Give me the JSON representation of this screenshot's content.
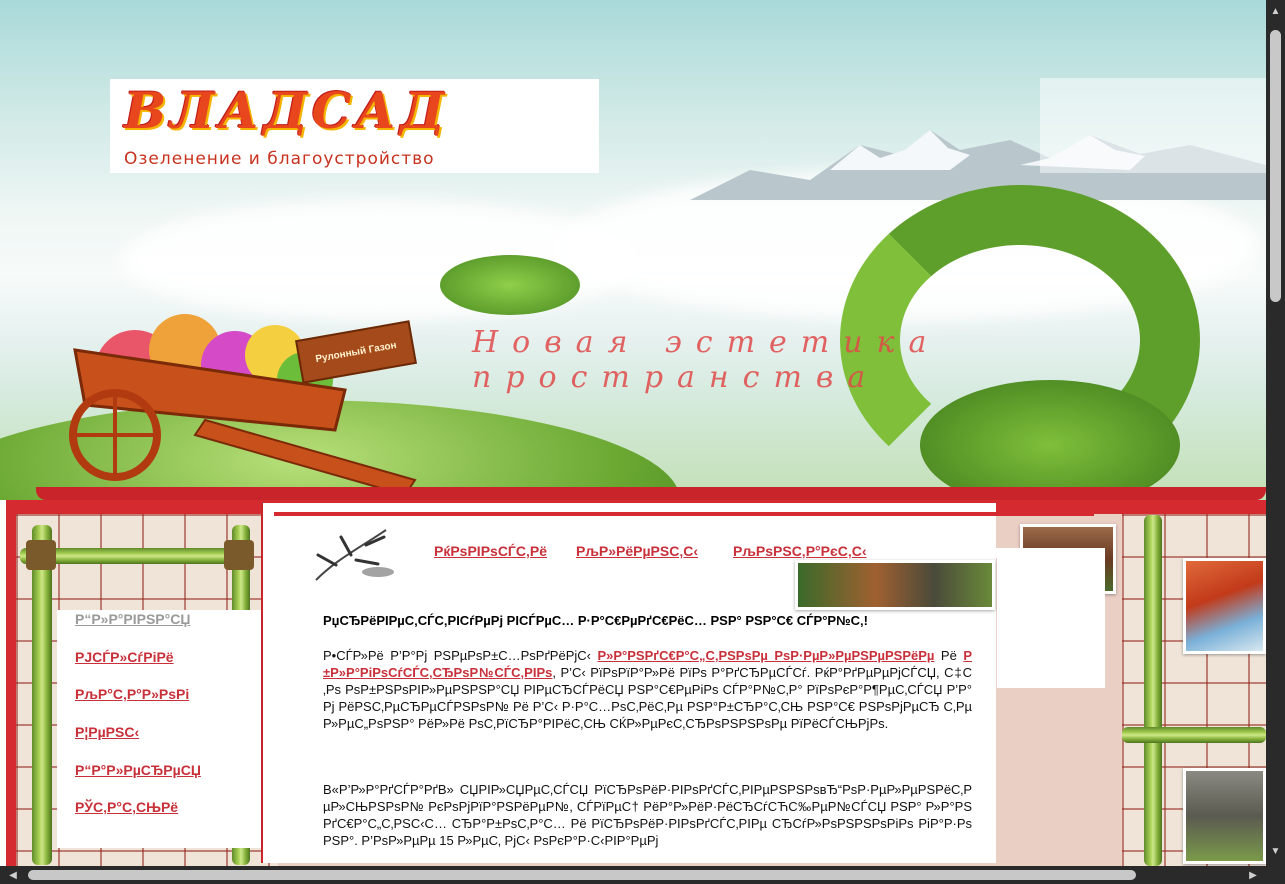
{
  "header": {
    "logo_word": "ВЛАДСАД",
    "logo_subtitle": "Озеленение и благоустройство",
    "tagline": "Новая эстетика пространства",
    "cart_sign": "Рулонный Газон"
  },
  "left_menu": {
    "items": [
      {
        "label": "Р“Р»Р°РІРЅР°СЏ",
        "active": true
      },
      {
        "label": "РЈСЃР»СѓРіРё",
        "active": false
      },
      {
        "label": "РљР°С‚Р°Р»РѕРі",
        "active": false
      },
      {
        "label": "Р¦РµРЅС‹",
        "active": false
      },
      {
        "label": "Р“Р°Р»РµСЂРµСЏ",
        "active": false
      },
      {
        "label": "РЎС‚Р°С‚СЊРё",
        "active": false
      }
    ]
  },
  "top_nav": {
    "links": [
      "РќРѕРІРѕСЃС‚Рё",
      "РљР»РёРµРЅС‚С‹",
      "РљРѕРЅС‚Р°РєС‚С‹"
    ]
  },
  "content": {
    "title": "РџСЂРёРІРµС‚СЃС‚РІСѓРµРј РІСЃРµС… Р·Р°С€РµРґС€РёС… РЅР° РЅР°С€ СЃР°Р№С‚!",
    "para1_a": "Р•СЃР»Рё Р’Р°Рј РЅРµРѕР±С…РѕРґРёРјС‹ ",
    "para1_link1": "Р»Р°РЅРґС€Р°С„С‚РЅРѕРµ РѕР·РµР»РµРЅРµРЅРёРµ",
    "para1_b": " Рё ",
    "para1_link2": "Р±Р»Р°РіРѕСѓСЃС‚СЂРѕР№СЃС‚РІРѕ",
    "para1_c": ", Р’С‹ РїРѕРїР°Р»Рё РїРѕ Р°РґСЂРµСЃСѓ. РќР°РґРµРµРјСЃСЏ, С‡С‚Рѕ РѕР±РЅРѕРІР»РµРЅРЅР°СЏ РІРµСЂСЃРёСЏ РЅР°С€РµРіРѕ СЃР°Р№С‚Р° РїРѕРєР°Р¶РµС‚СЃСЏ Р’Р°Рј РёРЅС‚РµСЂРµСЃРЅРѕР№ Рё Р’С‹ Р·Р°С…РѕС‚РёС‚Рµ РЅР°Р±СЂР°С‚СЊ РЅР°С€ РЅРѕРјРµСЂ С‚РµР»РµС„РѕРЅР° РёР»Рё РѕС‚РїСЂР°РІРёС‚СЊ СЌР»РµРєС‚СЂРѕРЅРЅРѕРµ РїРёСЃСЊРјРѕ.",
    "para2": "В«Р’Р»Р°РґСЃР°РґВ» СЏРІР»СЏРµС‚СЃСЏ РїСЂРѕРёР·РІРѕРґСЃС‚РІРµРЅРЅРѕвЂ“РѕР·РµР»РµРЅРёС‚РµР»СЊРЅРѕР№ РєРѕРјРїР°РЅРёРµР№, СЃРїРµС† РёР°Р»РёР·РёСЂСѓСЋС‰РµР№СЃСЏ РЅР° Р»Р°РЅРґС€Р°С„С‚РЅС‹С… СЂР°Р±РѕС‚Р°С… Рё РїСЂРѕРёР·РІРѕРґСЃС‚РІРµ СЂСѓР»РѕРЅРЅРѕРіРѕ РіР°Р·РѕРЅР°. Р’РѕР»РµРµ 15 Р»РµС‚ РјС‹ РѕРєР°Р·С‹РІР°РµРј"
  },
  "colors": {
    "brand_red": "#d52a2f",
    "link_red": "#c8303a",
    "bamboo_green": "#8fbf3c"
  }
}
